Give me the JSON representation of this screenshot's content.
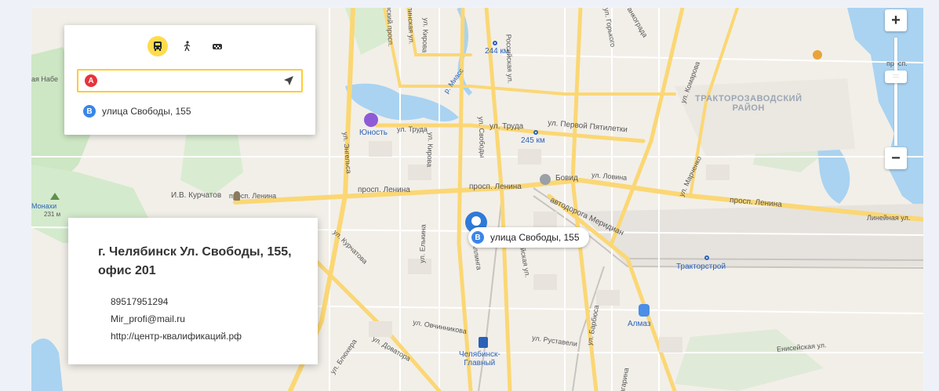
{
  "route": {
    "modes": [
      {
        "name": "bus",
        "icon": "bus-icon",
        "active": true
      },
      {
        "name": "walk",
        "icon": "walking-icon",
        "active": false
      },
      {
        "name": "taxi",
        "icon": "taxi-icon",
        "active": false
      }
    ],
    "point_a_badge": "A",
    "point_a_value": "",
    "point_b_badge": "B",
    "point_b_text": "улица Свободы, 155"
  },
  "zoom": {
    "plus": "+",
    "minus": "−",
    "handle": "::::"
  },
  "info": {
    "title": "г. Челябинск Ул. Свободы, 155, офис 201",
    "phone": "89517951294",
    "email": "Mir_profi@mail.ru",
    "site": "http://центр-квалификаций.рф"
  },
  "pin": {
    "badge": "B",
    "label": "улица Свободы, 155"
  },
  "labels": {
    "km244": "244 км",
    "km245": "245 км",
    "yunost": "Юность",
    "kurchatov": "И.В. Курчатов",
    "monakhi": "Монахи",
    "monakhi_h": "231 м",
    "bovid": "Бовид",
    "almaz": "Алмаз",
    "traktorostroy": "Тракторстрой",
    "chel_main": "Челябинск-\nГлавный",
    "district": "ТРАКТОРОЗАВОДСКИЙ\nРАЙОН",
    "pr_lenina1": "просп. Ленина",
    "pr_lenina2": "просп. Ленина",
    "pr_lenina3": "просп. Ленина",
    "pr_lenina4": "просп. Ленина",
    "truda1": "ул. Труда",
    "truda2": "ул. Труда",
    "pervoy": "ул. Первой Пятилетки",
    "lovina": "ул. Ловина",
    "merid": "автодорога Меридиан",
    "lineynaya": "Линейная ул.",
    "eniseyskaya": "Енисейская ул.",
    "rustaveli": "ул. Руставели",
    "ovchinnikova": "ул. Овчинникова",
    "dovatora": "ул. Доватора",
    "blyukhera": "ул. Блюхера",
    "kurchatova": "ул. Курчатова",
    "tsvillinga": "ул. Цвиллинга",
    "rossiyskaya": "Российская ул.",
    "rossiyskaya2": "Российская ул.",
    "svobody": "ул. Свободы",
    "kirova": "ул. Кирова",
    "kirova2": "ул. Кирова",
    "engelsa": "ул. Энгельса",
    "sverdl": "Свердловский просп.",
    "kaslinskaya": "Каслинская ул.",
    "komarova": "ул. Комарова",
    "gorkogo": "ул. Горького",
    "marchenko": "ул. Марченко",
    "barbyusa": "ул. Барбюса",
    "gagarina": "ул. Гагарина",
    "elkina": "ул. Елькина",
    "prosp_top": "просп.",
    "miass": "р. Миасс",
    "nabe": "ая Набе",
    "tankograd": "в Танкограда"
  }
}
